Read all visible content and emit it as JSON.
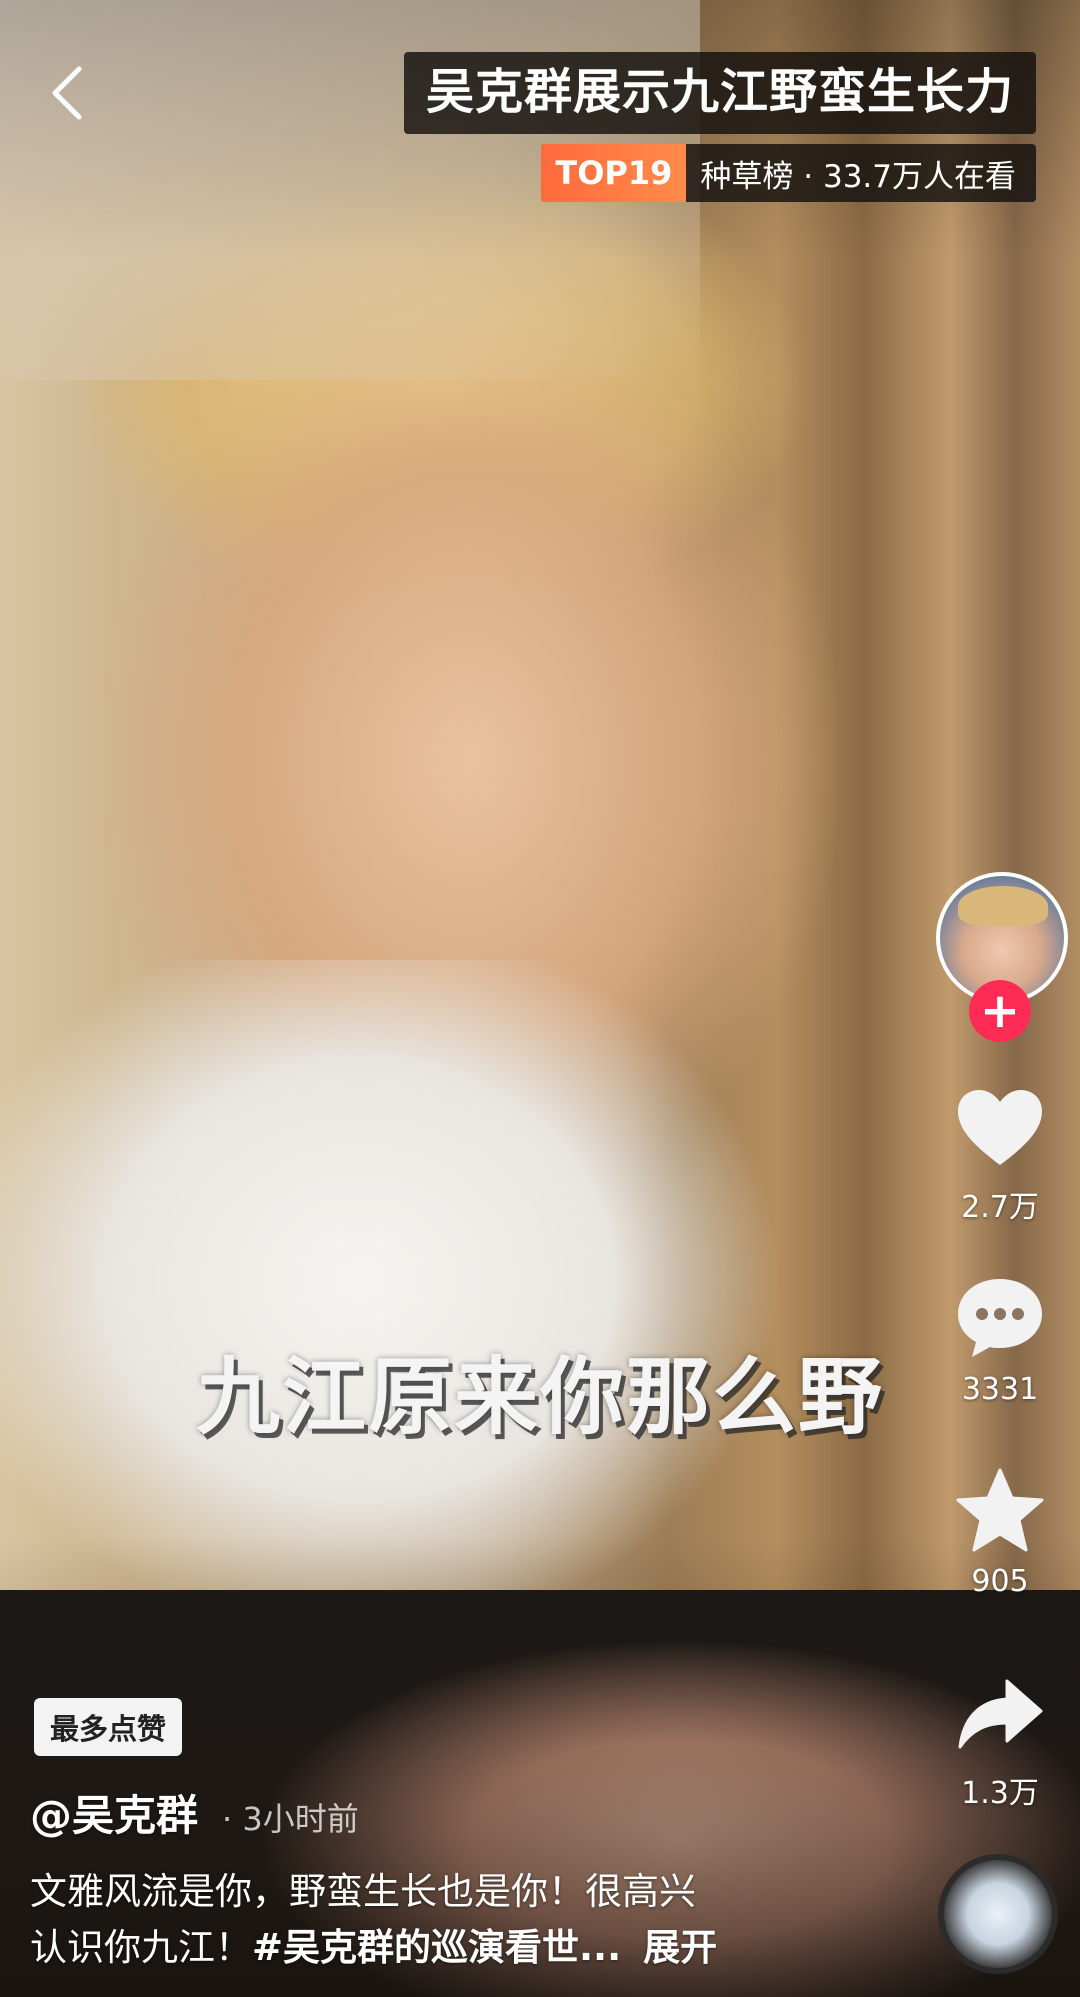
{
  "header": {
    "title": "吴克群展示九江野蛮生长力",
    "hot_badge": "TOP19",
    "hot_text": "种草榜 · 33.7万人在看"
  },
  "video": {
    "caption": "九江原来你那么野"
  },
  "rail": {
    "like_count": "2.7万",
    "comment_count": "3331",
    "favorite_count": "905",
    "share_count": "1.3万"
  },
  "info": {
    "tag": "最多点赞",
    "author": "@吴克群",
    "time": "· 3小时前",
    "desc_line1": "文雅风流是你，野蛮生长也是你！很高兴",
    "desc_line2_plain": "认识你九江！",
    "desc_hashtag": "#吴克群的巡演看世...",
    "expand_label": "展开"
  },
  "colors": {
    "accent": "#fe2c55",
    "hot_badge": "#ff7a44"
  }
}
